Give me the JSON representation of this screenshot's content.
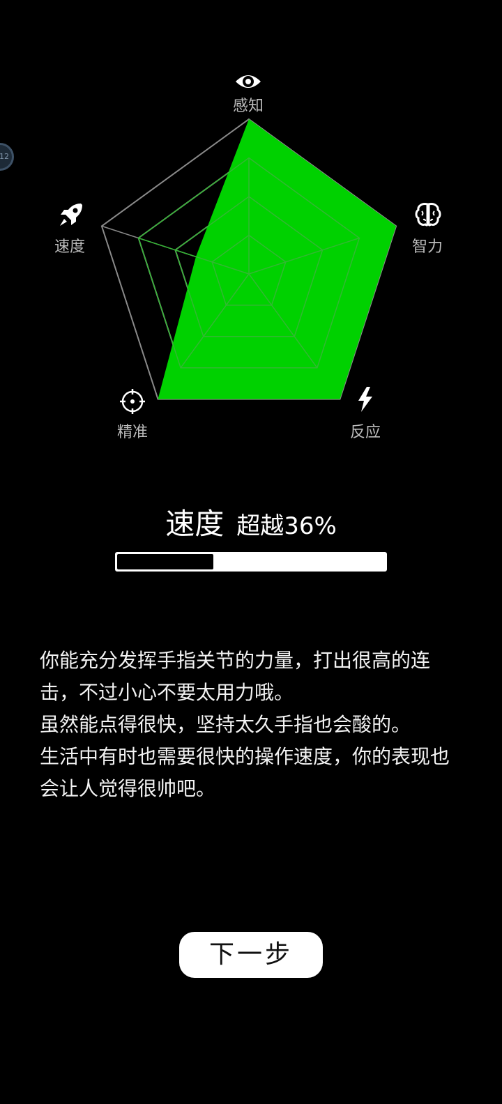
{
  "badge": {
    "text": "12"
  },
  "radar": {
    "axes": [
      {
        "label": "感知",
        "icon": "eye-icon",
        "value": 1.0
      },
      {
        "label": "智力",
        "icon": "brain-icon",
        "value": 1.0
      },
      {
        "label": "反应",
        "icon": "lightning-icon",
        "value": 1.0
      },
      {
        "label": "精准",
        "icon": "crosshair-icon",
        "value": 1.0
      },
      {
        "label": "速度",
        "icon": "rocket-icon",
        "value": 0.36
      }
    ],
    "fill_color": "#00d100",
    "grid_color": "#8a8a8a",
    "inner_grid_color": "#33b833"
  },
  "score": {
    "title": "速度",
    "subtitle": "超越36%",
    "progress": 0.36
  },
  "description": {
    "paragraphs": [
      "你能充分发挥手指关节的力量，打出很高的连击，不过小心不要太用力哦。",
      "虽然能点得很快，坚持太久手指也会酸的。",
      "生活中有时也需要很快的操作速度，你的表现也会让人觉得很帅吧。"
    ]
  },
  "next_button": {
    "label": "下一步"
  }
}
